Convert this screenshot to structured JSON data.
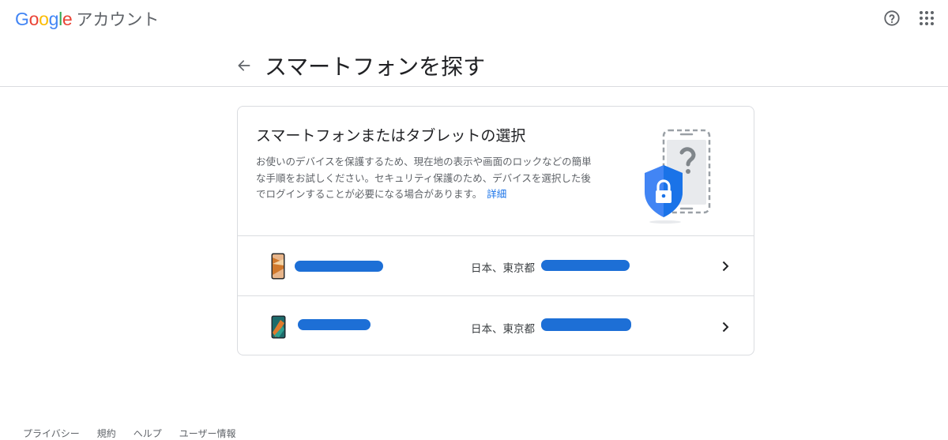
{
  "header": {
    "logo_letters": [
      "G",
      "o",
      "o",
      "g",
      "l",
      "e"
    ],
    "logo_colors": [
      "#4285F4",
      "#EA4335",
      "#FBBC05",
      "#4285F4",
      "#34A853",
      "#EA4335"
    ],
    "product": "アカウント",
    "help_icon": "help-circle-icon",
    "apps_icon": "apps-grid-icon"
  },
  "page": {
    "back_icon": "arrow-left-icon",
    "title": "スマートフォンを探す"
  },
  "card": {
    "title": "スマートフォンまたはタブレットの選択",
    "description": "お使いのデバイスを保護するため、現在地の表示や画面のロックなどの簡単な手順をお試しください。セキュリティ保護のため、デバイスを選択した後でログインすることが必要になる場合があります。",
    "learn_more": "詳細",
    "illustration": "phone-with-shield-lock-icon",
    "accent": "#1a73e8"
  },
  "devices": [
    {
      "thumbnail": "phone-thumbnail-icon",
      "location": "日本、東京都",
      "chevron": "chevron-right-icon"
    },
    {
      "thumbnail": "tablet-thumbnail-icon",
      "location": "日本、東京都",
      "chevron": "chevron-right-icon"
    }
  ],
  "footer": {
    "links": [
      "プライバシー",
      "規約",
      "ヘルプ",
      "ユーザー情報"
    ]
  }
}
